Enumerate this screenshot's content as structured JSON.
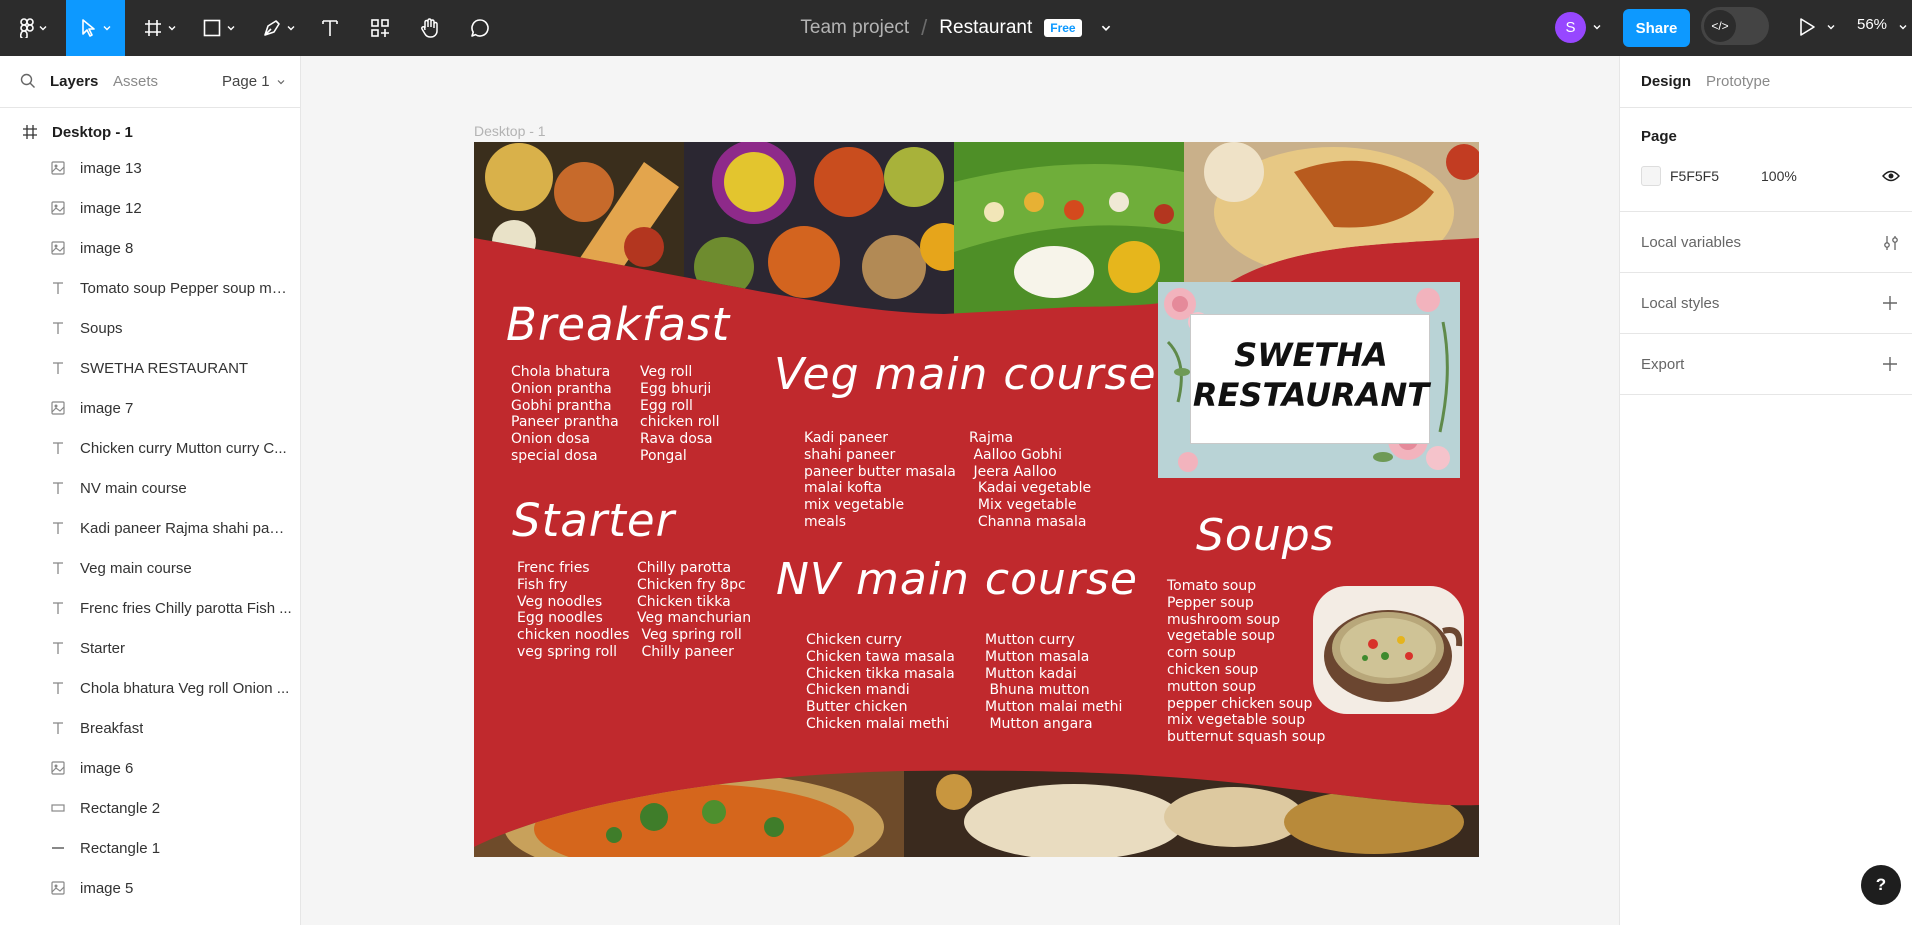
{
  "toolbar": {
    "tools": [
      "main-menu",
      "move",
      "frame",
      "shape",
      "pen",
      "text",
      "resources",
      "hand",
      "comment"
    ],
    "breadcrumb": {
      "project": "Team project",
      "separator": "/",
      "file": "Restaurant",
      "plan_badge": "Free"
    },
    "avatar_initial": "S",
    "share_label": "Share",
    "devmode_label": "</>",
    "zoom": "56%"
  },
  "left_panel": {
    "tabs": {
      "layers": "Layers",
      "assets": "Assets"
    },
    "page_selector": "Page 1",
    "root_frame": "Desktop - 1",
    "layers": [
      {
        "type": "image",
        "name": "image 13"
      },
      {
        "type": "image",
        "name": "image 12"
      },
      {
        "type": "image",
        "name": "image 8"
      },
      {
        "type": "text",
        "name": "Tomato soup Pepper soup mu..."
      },
      {
        "type": "text",
        "name": "Soups"
      },
      {
        "type": "text",
        "name": "SWETHA RESTAURANT"
      },
      {
        "type": "image",
        "name": "image 7"
      },
      {
        "type": "text",
        "name": "Chicken curry Mutton curry C..."
      },
      {
        "type": "text",
        "name": "NV main course"
      },
      {
        "type": "text",
        "name": "Kadi paneer Rajma shahi pane..."
      },
      {
        "type": "text",
        "name": "Veg main course"
      },
      {
        "type": "text",
        "name": "Frenc fries Chilly parotta Fish ..."
      },
      {
        "type": "text",
        "name": "Starter"
      },
      {
        "type": "text",
        "name": "Chola bhatura Veg roll Onion ..."
      },
      {
        "type": "text",
        "name": "Breakfast"
      },
      {
        "type": "image",
        "name": "image 6"
      },
      {
        "type": "rect",
        "name": "Rectangle 2"
      },
      {
        "type": "line",
        "name": "Rectangle 1"
      },
      {
        "type": "image",
        "name": "image 5"
      }
    ]
  },
  "right_panel": {
    "tabs": {
      "design": "Design",
      "prototype": "Prototype"
    },
    "page": {
      "label": "Page",
      "color_hex": "F5F5F5",
      "opacity": "100%"
    },
    "sections": [
      "Local variables",
      "Local styles",
      "Export"
    ]
  },
  "canvas": {
    "frame_label": "Desktop - 1",
    "menu": {
      "breakfast": {
        "title": "Breakfast",
        "col1": [
          "Chola bhatura",
          "Onion prantha",
          "Gobhi prantha",
          "Paneer prantha",
          "Onion dosa",
          "special dosa"
        ],
        "col2": [
          "Veg roll",
          "Egg bhurji",
          "Egg roll",
          "chicken roll",
          "Rava dosa",
          "Pongal"
        ]
      },
      "starter": {
        "title": "Starter",
        "col1": [
          "Frenc fries",
          "Fish fry",
          "Veg noodles",
          "Egg noodles",
          "chicken noodles",
          "veg spring roll"
        ],
        "col2": [
          "Chilly parotta",
          "Chicken fry 8pc",
          "Chicken tikka",
          "Veg manchurian",
          " Veg spring roll",
          " Chilly paneer"
        ]
      },
      "veg": {
        "title": "Veg main course",
        "col1": [
          "Kadi paneer",
          "shahi paneer",
          "paneer butter masala",
          "malai kofta",
          "mix vegetable",
          "meals"
        ],
        "col2": [
          "Rajma",
          " Aalloo Gobhi",
          " Jeera Aalloo",
          "  Kadai vegetable",
          "  Mix vegetable",
          "  Channa masala"
        ]
      },
      "nv": {
        "title": "NV main course",
        "col1": [
          "Chicken curry",
          "Chicken tawa masala",
          "Chicken tikka masala",
          "Chicken mandi",
          "Butter chicken",
          "Chicken malai methi"
        ],
        "col2": [
          "Mutton curry",
          "Mutton masala",
          "Mutton kadai",
          " Bhuna mutton",
          "Mutton malai methi",
          " Mutton angara"
        ]
      },
      "soups": {
        "title": "Soups",
        "items": [
          "Tomato soup",
          "Pepper soup",
          "mushroom soup",
          "vegetable soup",
          "corn soup",
          "chicken soup",
          "mutton soup",
          "pepper chicken soup",
          "mix vegetable soup",
          "butternut squash soup"
        ]
      },
      "logo": "SWETHA RESTAURANT"
    }
  },
  "help_label": "?",
  "colors": {
    "toolbar_bg": "#2c2c2c",
    "accent": "#0d99ff",
    "menu_red": "#c0292d",
    "avatar": "#9747ff",
    "canvas_bg": "#f5f5f5"
  }
}
